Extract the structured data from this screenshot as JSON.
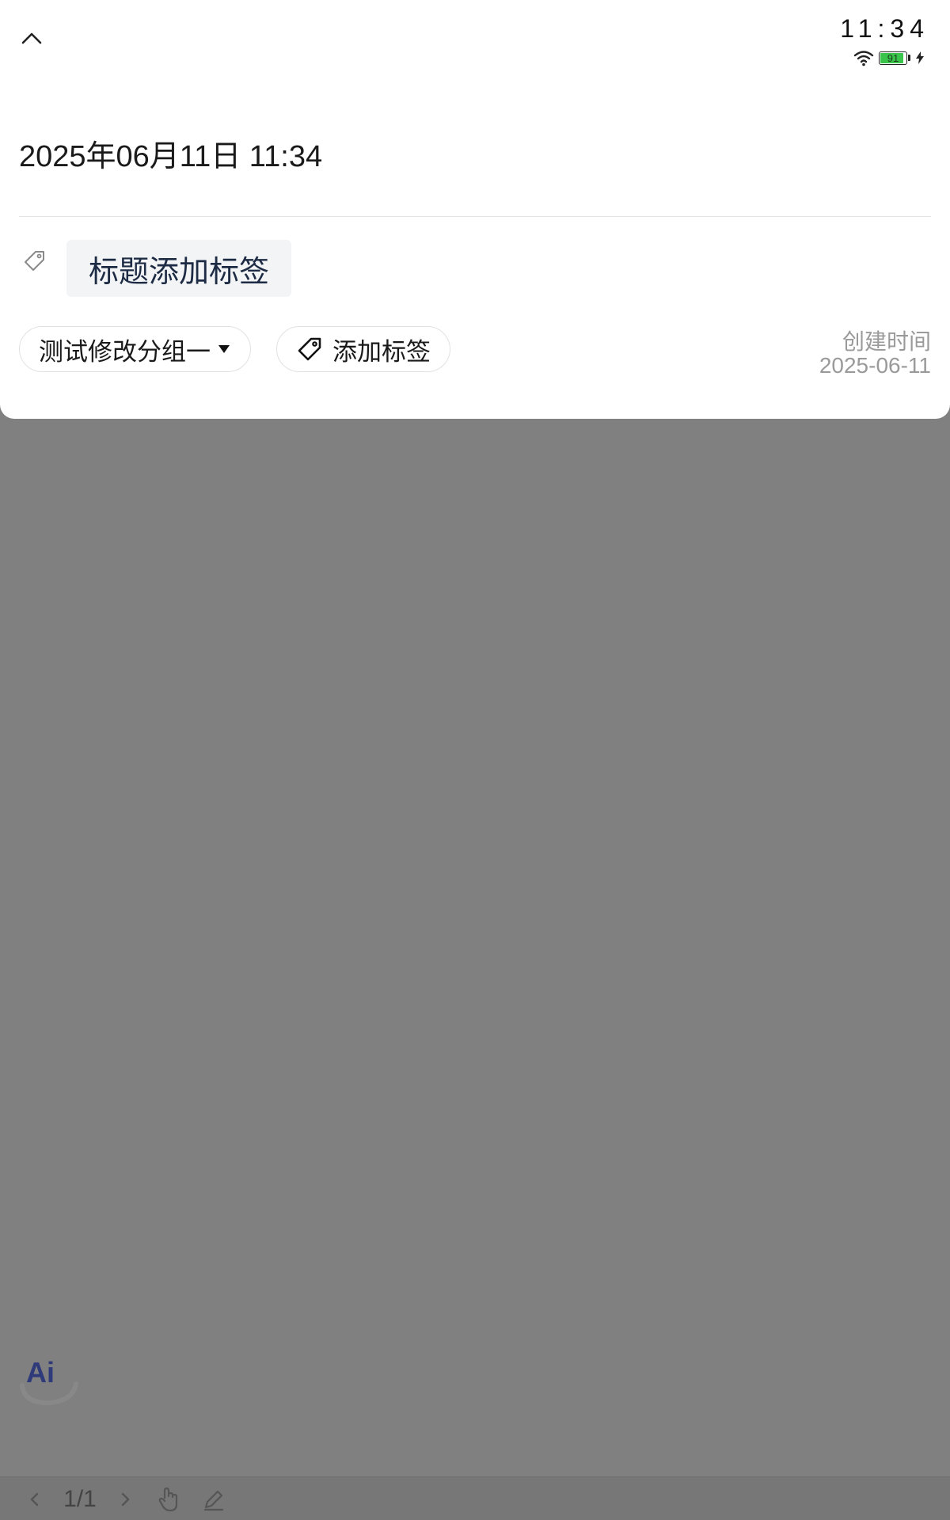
{
  "status_bar": {
    "time": "11:34",
    "battery_level": "91",
    "icons": [
      "wifi-icon",
      "battery-icon",
      "charging-icon"
    ]
  },
  "header": {
    "collapse_icon": "chevron-up-icon"
  },
  "note": {
    "datetime": "2025年06月11日 11:34",
    "title_tag_placeholder": "标题添加标签",
    "group_label": "测试修改分组一",
    "add_tag_label": "添加标签",
    "created_label": "创建时间",
    "created_date": "2025-06-11"
  },
  "ai_button": {
    "label": "Ai"
  },
  "bottom_toolbar": {
    "page_indicator": "1/1",
    "icons": [
      "prev-page-icon",
      "next-page-icon",
      "hand-tool-icon",
      "pen-tool-icon"
    ]
  },
  "colors": {
    "overlay": "#808080",
    "sheet": "#ffffff",
    "battery_fill": "#3bc44b",
    "muted_text": "#9a9a9a"
  }
}
